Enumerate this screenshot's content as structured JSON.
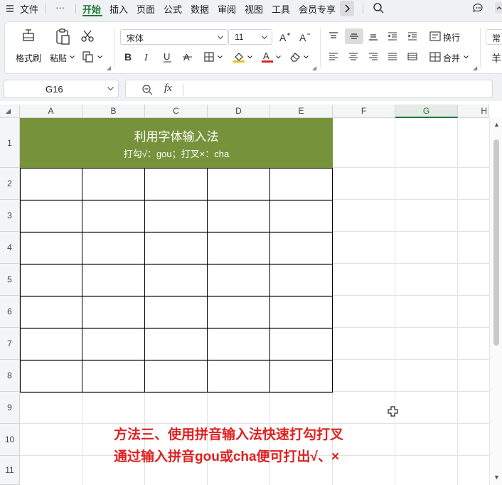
{
  "menu": {
    "items": [
      "文件",
      "···",
      "开始",
      "插入",
      "页面",
      "公式",
      "数据",
      "审阅",
      "视图",
      "工具",
      "会员专享"
    ],
    "active": "开始"
  },
  "ribbon": {
    "format_painter": "格式刷",
    "paste": "粘贴",
    "font_name": "宋体",
    "font_size": "11",
    "wrap_text": "换行",
    "merge": "合并",
    "number_format_partial": "常",
    "currency_partial": "羊"
  },
  "formula_bar": {
    "name_box": "G16",
    "fx": "fx",
    "value": ""
  },
  "grid": {
    "columns": [
      "A",
      "B",
      "C",
      "D",
      "E",
      "F",
      "G",
      "H"
    ],
    "selected_column": "G",
    "rows": [
      "1",
      "2",
      "3",
      "4",
      "5",
      "6",
      "7",
      "8",
      "9",
      "10",
      "11"
    ]
  },
  "sheet": {
    "title": "利用字体输入法",
    "subtitle": "打勾√：gou；打叉×：cha",
    "banner_color": "#76933c"
  },
  "note": {
    "line1": "方法三、使用拼音输入法快速打勾打叉",
    "line2": "通过输入拼音gou或cha便可打出√、×",
    "color": "#e02020"
  },
  "colors": {
    "accent": "#1f7a3a"
  }
}
